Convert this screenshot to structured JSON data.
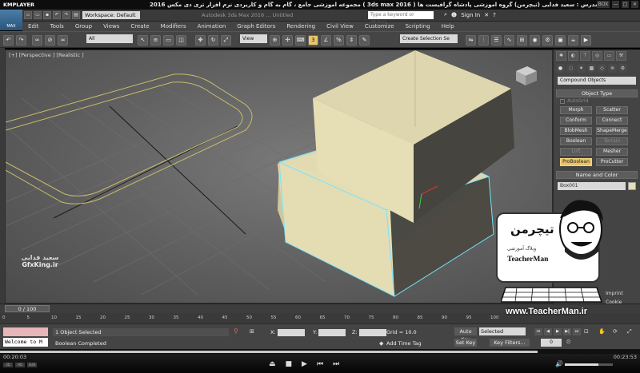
{
  "kmplayer": {
    "logo": "KMPLAYER",
    "caption": "مجموعه آموزشی جامع ، گام به گام و کاربردی نرم افزار تری دی مکس 2016 ( 3ds max 2016 ) مدرس : سعید فدایی (تیچرمن) گروه آموزشی پادشاه گرافیست ها",
    "window_buttons": [
      "BOX",
      "—",
      "□",
      "✕"
    ],
    "time_elapsed": "00:20:03",
    "time_total": "00:23:53",
    "progress": 0.84,
    "volume": 0.7,
    "small_buttons": [
      "3D",
      "HD",
      "SUB"
    ]
  },
  "max": {
    "logo": "MAX",
    "workspace": "Workspace: Default",
    "document_title": "Autodesk 3ds Max 2016 ...  Untitled",
    "search_placeholder": "Type a keyword or phrase",
    "sign_in": "Sign In",
    "help": "?",
    "menus": [
      "Edit",
      "Tools",
      "Group",
      "Views",
      "Create",
      "Modifiers",
      "Animation",
      "Graph Editors",
      "Rendering",
      "Civil View",
      "Customize",
      "Scripting",
      "Help"
    ],
    "toolbar": {
      "filter": "All",
      "ref_coord": "View",
      "selection_set": "Create Selection Se"
    },
    "viewport_label": "[+] [Perspective ] [Realistic ]",
    "command_panel": {
      "dropdown": "Compound Objects",
      "object_type_title": "Object Type",
      "autogrid": "AutoGrid",
      "buttons": [
        {
          "label": "Morph",
          "state": "normal"
        },
        {
          "label": "Scatter",
          "state": "normal"
        },
        {
          "label": "Conform",
          "state": "normal"
        },
        {
          "label": "Connect",
          "state": "normal"
        },
        {
          "label": "BlobMesh",
          "state": "normal"
        },
        {
          "label": "ShapeMerge",
          "state": "normal"
        },
        {
          "label": "Boolean",
          "state": "normal"
        },
        {
          "label": "Terrain",
          "state": "disabled"
        },
        {
          "label": "Loft",
          "state": "disabled"
        },
        {
          "label": "Mesher",
          "state": "normal"
        },
        {
          "label": "ProBoolean",
          "state": "active"
        },
        {
          "label": "ProCutter",
          "state": "normal"
        }
      ],
      "name_color_title": "Name and Color",
      "object_name": "Box001",
      "object_color": "#e4e0b8"
    },
    "timeline": {
      "slider": "0 / 100",
      "ticks": [
        "0",
        "5",
        "10",
        "15",
        "20",
        "25",
        "30",
        "35",
        "40",
        "45",
        "50",
        "55",
        "60",
        "65",
        "70",
        "75",
        "80",
        "85",
        "90",
        "95",
        "100"
      ]
    },
    "status": {
      "listener": "Welcome to M",
      "selection": "1 Object Selected",
      "prompt": "Boolean Completed",
      "x_label": "X:",
      "y_label": "Y:",
      "z_label": "Z:",
      "grid": "Grid = 10.0",
      "add_time_tag": "Add Time Tag",
      "auto_key": "Auto Key",
      "set_key": "Set Key",
      "selected": "Selected",
      "key_filters": "Key Filters...",
      "frame": "0"
    }
  },
  "watermarks": {
    "gfx_fa": "سعید فدایی",
    "gfx_en": "GfxKing.ir",
    "tm_fa": "تیچرمن",
    "tm_fa_sub": "وبلاگ آموزشی",
    "tm_en": "TeacherMan",
    "tm_url": "www.TeacherMan.ir",
    "right_fragments": [
      "Imprint",
      "Cookie"
    ]
  }
}
